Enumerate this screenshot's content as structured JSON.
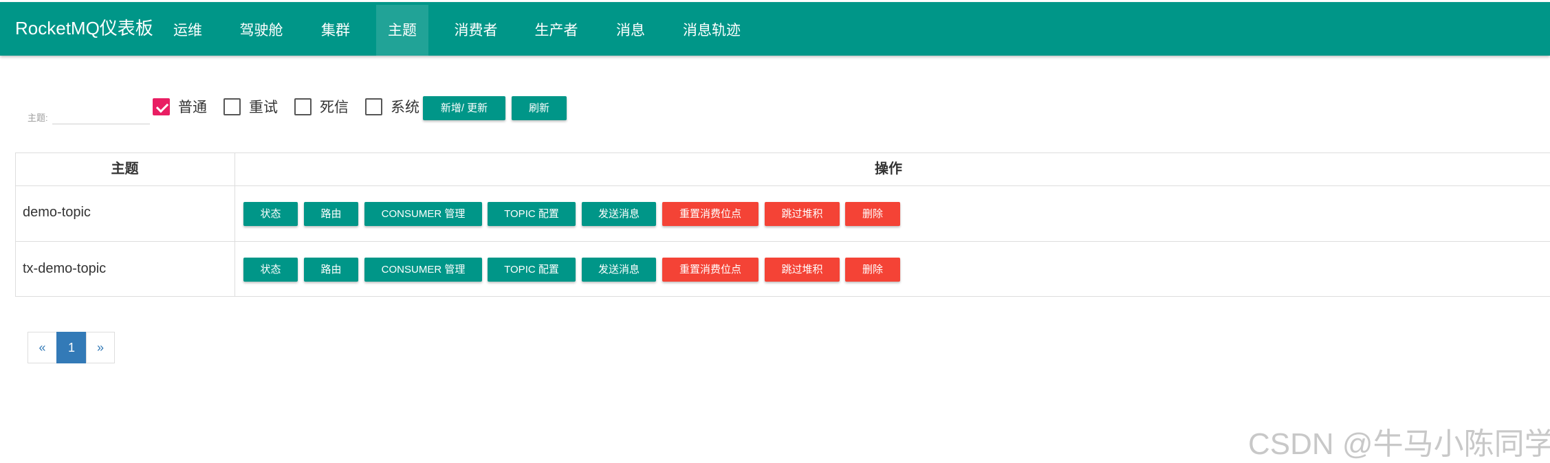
{
  "nav": {
    "brand": "RocketMQ仪表板",
    "items": [
      {
        "label": "运维"
      },
      {
        "label": "驾驶舱"
      },
      {
        "label": "集群"
      },
      {
        "label": "主题"
      },
      {
        "label": "消费者"
      },
      {
        "label": "生产者"
      },
      {
        "label": "消息"
      },
      {
        "label": "消息轨迹"
      }
    ],
    "active": "主题"
  },
  "filter": {
    "label": "主题:",
    "value": "",
    "checkboxes": [
      {
        "label": "普通",
        "checked": true
      },
      {
        "label": "重试",
        "checked": false
      },
      {
        "label": "死信",
        "checked": false
      },
      {
        "label": "系统",
        "checked": false
      }
    ],
    "add_update_label": "新增/ 更新",
    "refresh_label": "刷新"
  },
  "table": {
    "headers": [
      "主题",
      "操作"
    ],
    "actions": [
      "状态",
      "路由",
      "CONSUMER 管理",
      "TOPIC 配置",
      "发送消息",
      "重置消费位点",
      "跳过堆积",
      "删除"
    ],
    "action_colors": [
      "#009688",
      "#009688",
      "#009688",
      "#009688",
      "#009688",
      "#f44336",
      "#f44336",
      "#f44336"
    ],
    "rows": [
      {
        "topic": "demo-topic"
      },
      {
        "topic": "tx-demo-topic"
      }
    ]
  },
  "pagination": {
    "prev": "«",
    "current": "1",
    "next": "»"
  },
  "watermark": "CSDN @牛马小陈同学"
}
